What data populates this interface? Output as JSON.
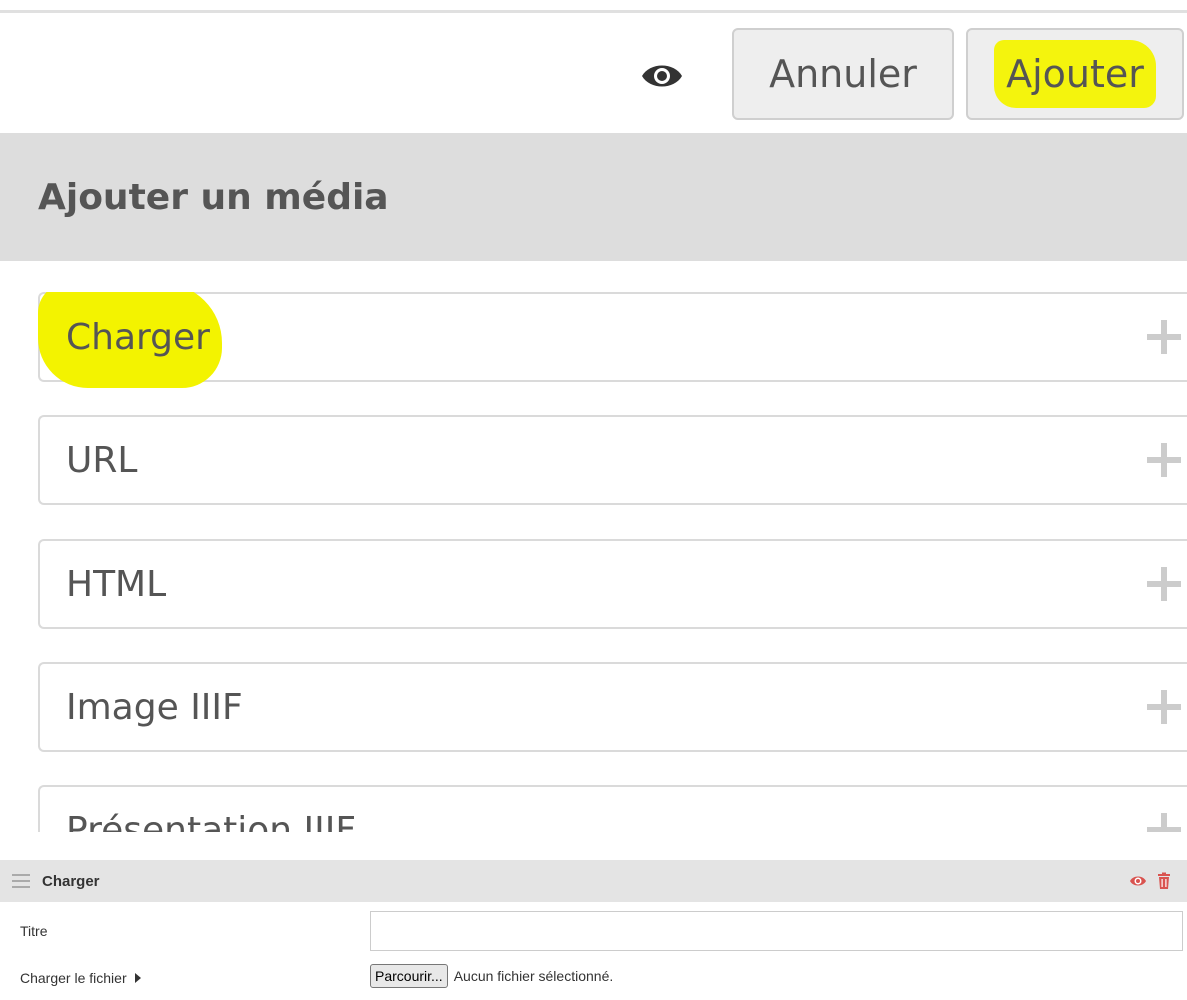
{
  "toolbar": {
    "preview_icon": "eye-icon",
    "cancel_label": "Annuler",
    "add_label": "Ajouter"
  },
  "sidebar": {
    "title": "Ajouter un média",
    "options": [
      {
        "label": "Charger",
        "icon": "plus-icon",
        "highlighted": true
      },
      {
        "label": "URL",
        "icon": "plus-icon"
      },
      {
        "label": "HTML",
        "icon": "plus-icon"
      },
      {
        "label": "Image IIIF",
        "icon": "plus-icon"
      },
      {
        "label": "Présentation IIIF",
        "icon": "plus-icon"
      }
    ]
  },
  "media_block": {
    "title": "Charger",
    "drag_icon": "drag-handle-icon",
    "actions": [
      "eye-icon",
      "trash-icon"
    ],
    "fields": {
      "title_label": "Titre",
      "title_value": "",
      "file_label": "Charger le fichier",
      "browse_label": "Parcourir...",
      "file_status": "Aucun fichier sélectionné."
    }
  },
  "colors": {
    "highlight": "#f3f300",
    "panel_header": "#dddddd",
    "delete_red": "#d9534f"
  }
}
